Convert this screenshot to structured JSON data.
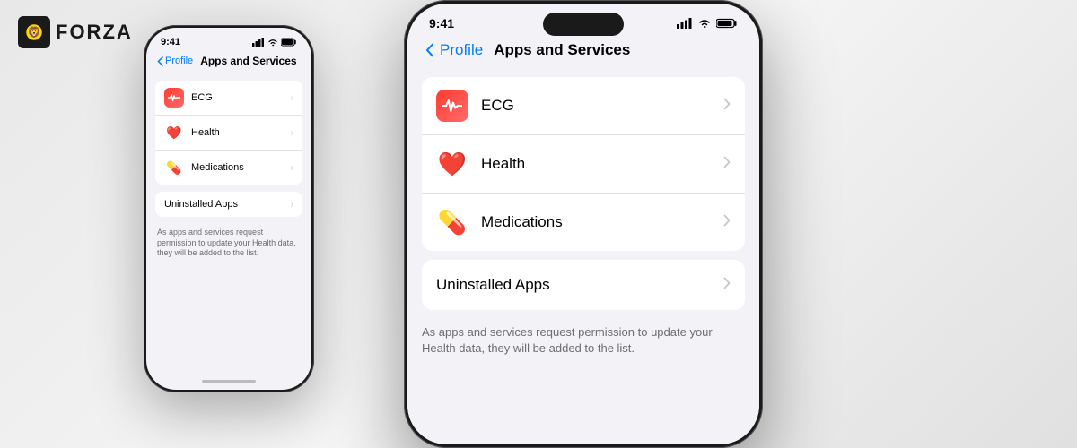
{
  "logo": {
    "text": "FORZA",
    "icon": "🦁"
  },
  "small_phone": {
    "status": {
      "time": "9:41",
      "signal": "▪▪▪▪",
      "wifi": "WiFi",
      "battery": "🔋"
    },
    "nav": {
      "back_label": "Profile",
      "title": "Apps and Services"
    },
    "items": [
      {
        "label": "ECG",
        "icon_type": "ecg"
      },
      {
        "label": "Health",
        "icon_type": "heart"
      },
      {
        "label": "Medications",
        "icon_type": "pills"
      }
    ],
    "uninstalled_section": "Uninstalled Apps",
    "footer_text": "As apps and services request permission to update your Health data, they will be added to the list."
  },
  "large_phone": {
    "status": {
      "time": "9:41",
      "signal": "signal",
      "wifi": "wifi",
      "battery": "battery"
    },
    "nav": {
      "back_label": "Profile",
      "title": "Apps and Services"
    },
    "items": [
      {
        "label": "ECG",
        "icon_type": "ecg"
      },
      {
        "label": "Health",
        "icon_type": "heart"
      },
      {
        "label": "Medications",
        "icon_type": "pills"
      }
    ],
    "uninstalled_section": "Uninstalled Apps",
    "footer_text": "As apps and services request permission to update your Health data, they will be added to the list."
  }
}
